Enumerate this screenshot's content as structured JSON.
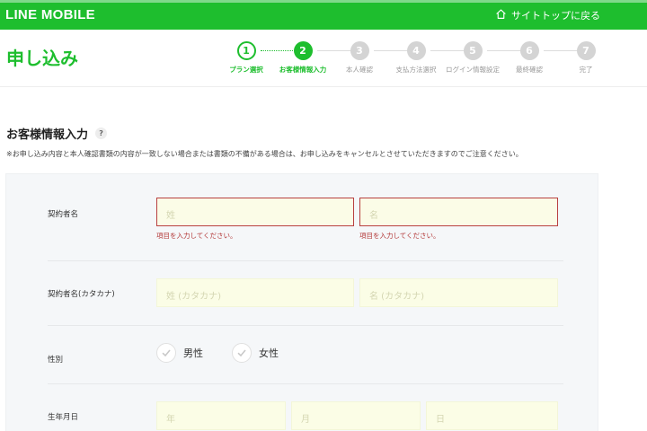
{
  "header": {
    "logo": "LINE MOBILE",
    "back_link": "サイトトップに戻る",
    "back_icon": "home-icon"
  },
  "page_title": "申し込み",
  "steps": [
    {
      "number": "1",
      "label": "プラン選択",
      "state": "done"
    },
    {
      "number": "2",
      "label": "お客様情報入力",
      "state": "current"
    },
    {
      "number": "3",
      "label": "本人確認",
      "state": "todo"
    },
    {
      "number": "4",
      "label": "支払方法選択",
      "state": "todo"
    },
    {
      "number": "5",
      "label": "ログイン情報設定",
      "state": "todo"
    },
    {
      "number": "6",
      "label": "最終確認",
      "state": "todo"
    },
    {
      "number": "7",
      "label": "完了",
      "state": "todo"
    }
  ],
  "section": {
    "title": "お客様情報入力",
    "help": "?",
    "notice": "※お申し込み内容と本人確認書類の内容が一致しない場合または書類の不備がある場合は、お申し込みをキャンセルとさせていただきますのでご注意ください。"
  },
  "form": {
    "name": {
      "label": "契約者名",
      "last_placeholder": "姓",
      "first_placeholder": "名",
      "last_error": "項目を入力してください。",
      "first_error": "項目を入力してください。"
    },
    "kana": {
      "label": "契約者名(カタカナ)",
      "last_placeholder": "姓 (カタカナ)",
      "first_placeholder": "名 (カタカナ)"
    },
    "gender": {
      "label": "性別",
      "male": "男性",
      "female": "女性"
    },
    "birthday": {
      "label": "生年月日",
      "year_placeholder": "年",
      "month_placeholder": "月",
      "day_placeholder": "日"
    }
  },
  "colors": {
    "brand_green": "#1ebe2e",
    "error_red": "#b33838",
    "field_bg": "#fbfde6"
  }
}
